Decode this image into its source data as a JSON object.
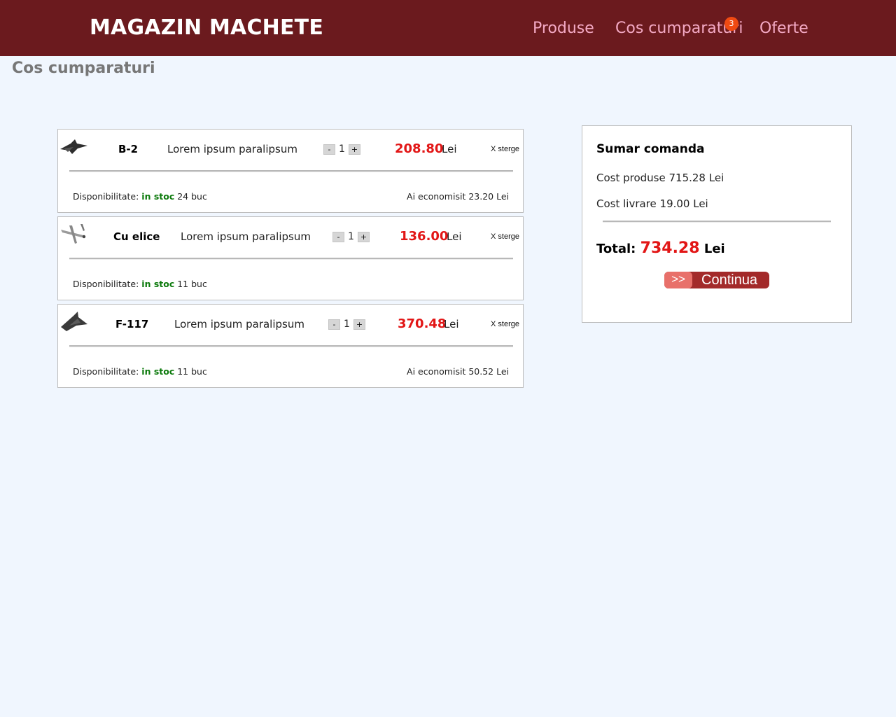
{
  "header": {
    "brand": "MAGAZIN MACHETE",
    "nav": {
      "produse": "Produse",
      "cos": "Cos cumparaturi",
      "oferte": "Oferte"
    },
    "cart_badge": "3"
  },
  "page_title": "Cos cumparaturi",
  "cart": {
    "items": [
      {
        "name": "B-2",
        "description": "Lorem ipsum paralipsum",
        "minus": "-",
        "qty": "1",
        "plus": "+",
        "price": "208.80",
        "currency": "Lei",
        "delete": "X sterge",
        "avail_label": "Disponibilitate:",
        "avail_status": "in stoc",
        "avail_count": "24 buc",
        "saved": "Ai economisit 23.20 Lei"
      },
      {
        "name": "Cu elice",
        "description": "Lorem ipsum paralipsum",
        "minus": "-",
        "qty": "1",
        "plus": "+",
        "price": "136.00",
        "currency": "Lei",
        "delete": "X sterge",
        "avail_label": "Disponibilitate:",
        "avail_status": "in stoc",
        "avail_count": "11 buc",
        "saved": ""
      },
      {
        "name": "F-117",
        "description": "Lorem ipsum paralipsum",
        "minus": "-",
        "qty": "1",
        "plus": "+",
        "price": "370.48",
        "currency": "Lei",
        "delete": "X sterge",
        "avail_label": "Disponibilitate:",
        "avail_status": "in stoc",
        "avail_count": "11 buc",
        "saved": "Ai economisit 50.52 Lei"
      }
    ]
  },
  "summary": {
    "title": "Sumar comanda",
    "products_cost": "Cost produse 715.28 Lei",
    "delivery_cost": "Cost livrare 19.00 Lei",
    "total_label": "Total:",
    "total_value": "734.28",
    "total_currency": "Lei",
    "continue_arrows": ">>",
    "continue_label": "Continua"
  },
  "colors": {
    "header_bg": "#6b1a1e",
    "nav_link": "#f3a9c4",
    "price": "#e21616",
    "stock": "#0c7a0c",
    "page_bg": "#f0f6fe",
    "button": "#a32a2a"
  }
}
